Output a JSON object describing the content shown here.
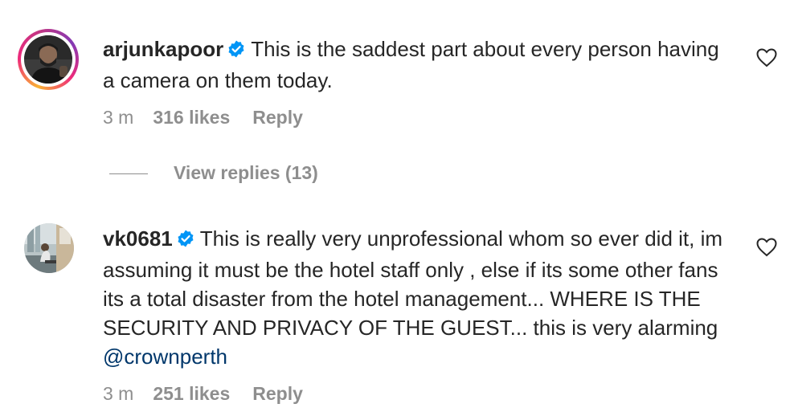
{
  "comments": [
    {
      "username": "arjunkapoor",
      "verified": true,
      "text": "This is the saddest part about every person having a camera on them today.",
      "time": "3 m",
      "likes": "316 likes",
      "reply_label": "Reply",
      "view_replies": "View replies (13)"
    },
    {
      "username": "vk0681",
      "verified": true,
      "text": "This is really very unprofessional whom so ever did it, im assuming it must be the hotel staff only , else if its some other fans its a total disaster from the hotel management... WHERE IS THE SECURITY AND PRIVACY OF THE GUEST... this is very alarming",
      "mention": "@crownperth",
      "time": "3 m",
      "likes": "251 likes",
      "reply_label": "Reply"
    }
  ],
  "colors": {
    "text": "#262626",
    "secondary": "#8e8e8e",
    "verified": "#0095f6",
    "mention": "#00376b"
  }
}
